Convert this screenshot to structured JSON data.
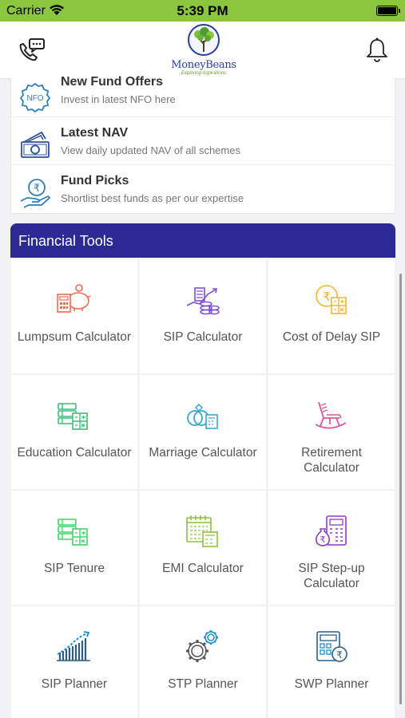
{
  "status_bar": {
    "carrier": "Carrier",
    "time": "5:39 PM"
  },
  "header": {
    "brand_name": "MoneyBeans",
    "tagline": "Exploring Aspirations",
    "call_icon": "phone-chat-icon",
    "notifications_icon": "bell-icon"
  },
  "menu": {
    "items": [
      {
        "title": "New Fund Offers",
        "subtitle": "Invest in latest NFO here",
        "icon": "nfo-badge-icon",
        "icon_text": "NFO"
      },
      {
        "title": "Latest NAV",
        "subtitle": "View daily updated NAV of all schemes",
        "icon": "money-stack-icon"
      },
      {
        "title": "Fund Picks",
        "subtitle": "Shortlist best funds as per our expertise",
        "icon": "rupee-hand-icon"
      }
    ]
  },
  "tools": {
    "title": "Financial Tools",
    "header_color": "#2b2a93",
    "items": [
      {
        "label": "Lumpsum Calculator",
        "icon": "piggy-bank-icon",
        "color": "#f26b4f"
      },
      {
        "label": "SIP Calculator",
        "icon": "coins-growth-icon",
        "color": "#7b4fd6"
      },
      {
        "label": "Cost of Delay SIP",
        "icon": "coin-calculator-icon",
        "color": "#f2b630"
      },
      {
        "label": "Education Calculator",
        "icon": "books-calculator-icon",
        "color": "#3cbf7a"
      },
      {
        "label": "Marriage Calculator",
        "icon": "rings-calculator-icon",
        "color": "#3aa8c9"
      },
      {
        "label": "Retirement Calculator",
        "icon": "rocking-chair-icon",
        "color": "#e0559c"
      },
      {
        "label": "SIP Tenure",
        "icon": "books-calculator-icon",
        "color": "#3fd66a"
      },
      {
        "label": "EMI Calculator",
        "icon": "calendar-calculator-icon",
        "color": "#8bc43f"
      },
      {
        "label": "SIP Step-up Calculator",
        "icon": "money-bag-calculator-icon",
        "color": "#8a3fc4"
      },
      {
        "label": "SIP Planner",
        "icon": "bar-growth-icon",
        "color": "#1e8fc9"
      },
      {
        "label": "STP Planner",
        "icon": "gears-icon",
        "color": "#1e8fc9"
      },
      {
        "label": "SWP Planner",
        "icon": "calculator-coin-icon",
        "color": "#1e8fc9"
      }
    ]
  }
}
